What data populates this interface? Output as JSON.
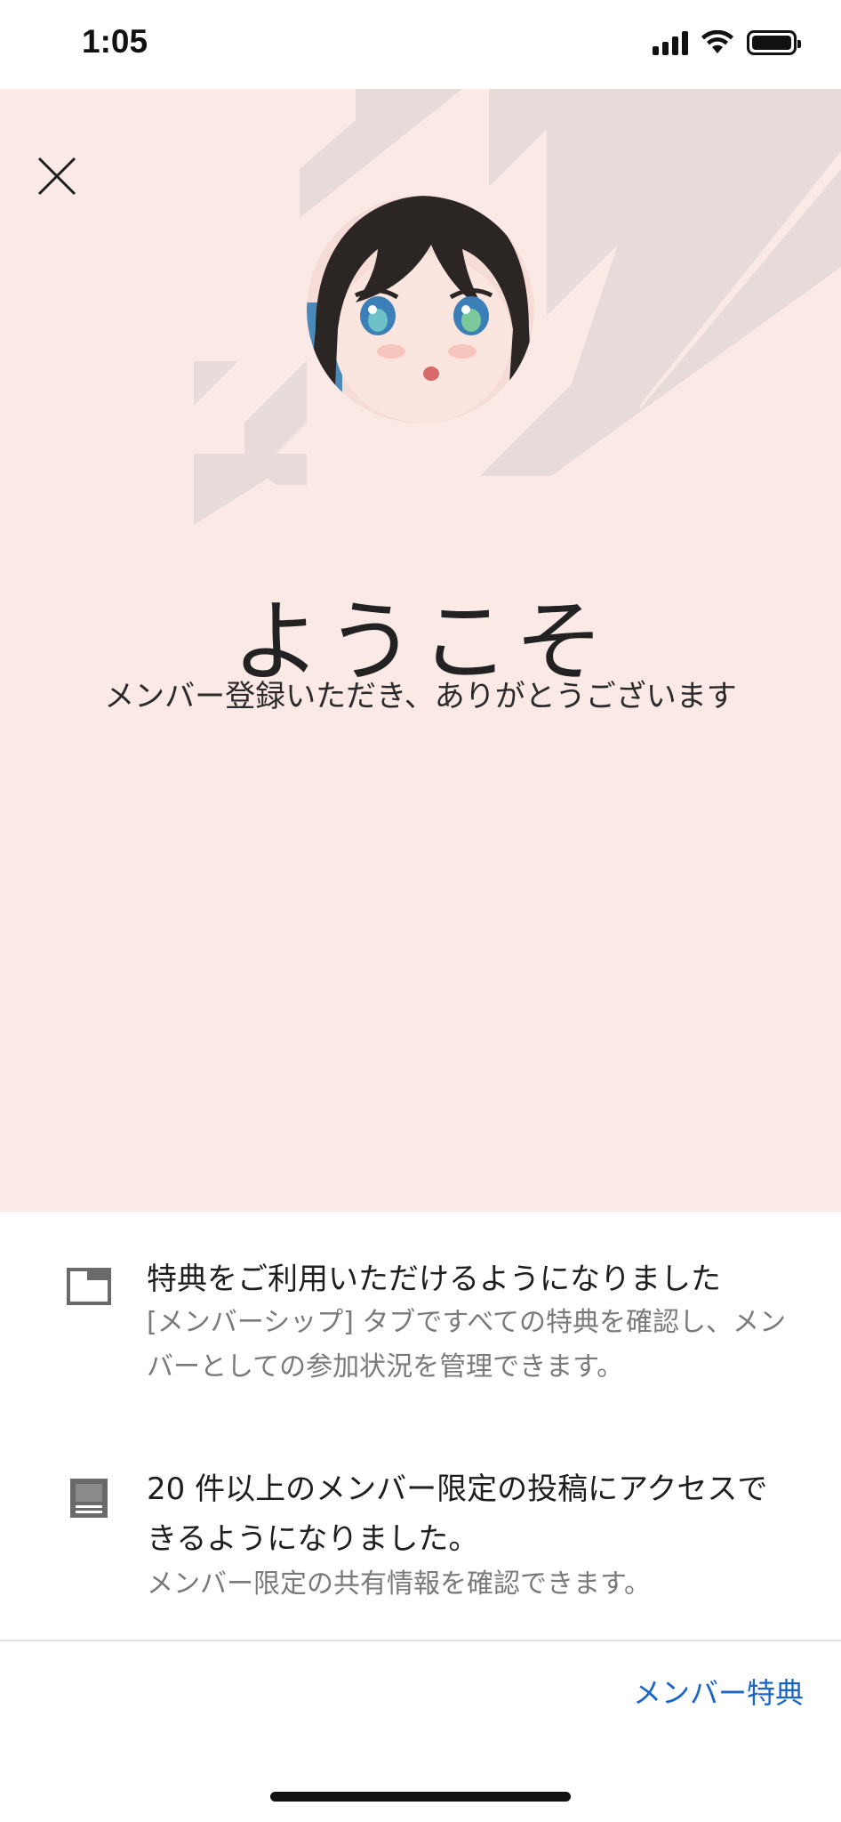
{
  "status_bar": {
    "time": "1:05",
    "icons": [
      "signal-icon",
      "wifi-icon",
      "battery-icon"
    ]
  },
  "hero": {
    "close_icon": "close-icon",
    "avatar_description": "channel-avatar",
    "title": "ようこそ",
    "subtitle": "メンバー登録いただき、ありがとうございます",
    "background_color": "#fbe9e5"
  },
  "benefits": [
    {
      "icon": "badge-tab-icon",
      "title": "特典をご利用いただけるようになりました",
      "description": "[メンバーシップ] タブですべての特典を確認し、メンバーとしての参加状況を管理できます。"
    },
    {
      "icon": "community-post-icon",
      "title": "20 件以上のメンバー限定の投稿にアクセスできるようになりました。",
      "description": "メンバー限定の共有情報を確認できます。"
    }
  ],
  "footer": {
    "link_label": "メンバー特典",
    "link_color": "#1a64c8"
  }
}
